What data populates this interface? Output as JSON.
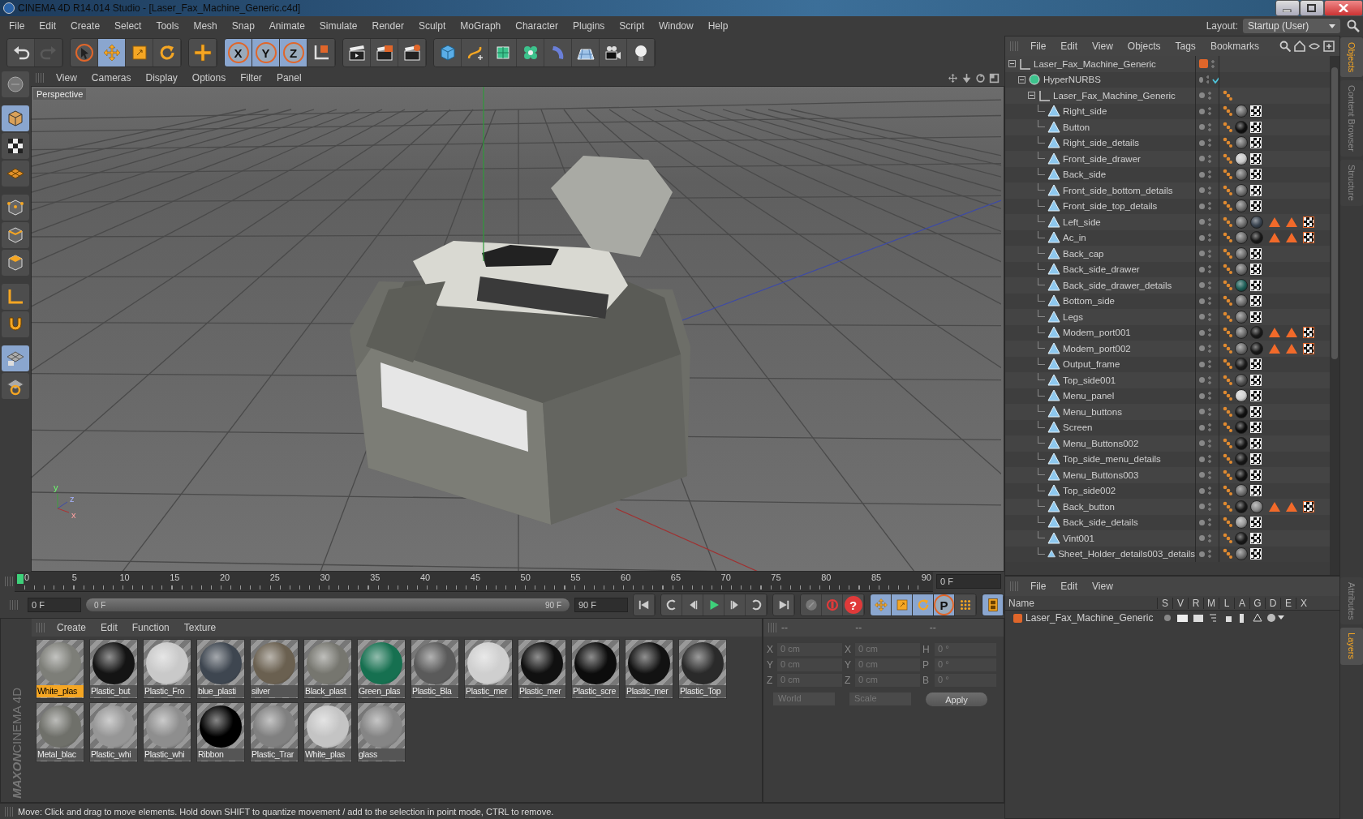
{
  "window": {
    "title": "CINEMA 4D R14.014 Studio - [Laser_Fax_Machine_Generic.c4d]"
  },
  "menu": [
    "File",
    "Edit",
    "Create",
    "Select",
    "Tools",
    "Mesh",
    "Snap",
    "Animate",
    "Simulate",
    "Render",
    "Sculpt",
    "MoGraph",
    "Character",
    "Plugins",
    "Script",
    "Window",
    "Help"
  ],
  "layout": {
    "label": "Layout:",
    "value": "Startup (User)"
  },
  "toolbar": [
    [
      {
        "kind": "undo",
        "disabled": false
      },
      {
        "kind": "redo",
        "disabled": true
      }
    ],
    [
      {
        "kind": "select",
        "selected": false
      },
      {
        "kind": "move",
        "selected": true
      },
      {
        "kind": "scale",
        "selected": false
      },
      {
        "kind": "rotate",
        "selected": false
      }
    ],
    [
      {
        "kind": "add",
        "selected": false
      }
    ],
    [
      {
        "kind": "axis",
        "label": "X",
        "selected": true
      },
      {
        "kind": "axis",
        "label": "Y",
        "selected": true
      },
      {
        "kind": "axis",
        "label": "Z",
        "selected": true
      },
      {
        "kind": "coordinate-system",
        "selected": false
      }
    ],
    [
      {
        "kind": "render-view",
        "selected": false
      },
      {
        "kind": "render",
        "selected": false
      },
      {
        "kind": "render-settings",
        "selected": false
      }
    ],
    [
      {
        "kind": "cube",
        "selected": false
      },
      {
        "kind": "spline",
        "selected": false
      },
      {
        "kind": "nurbs",
        "selected": false
      },
      {
        "kind": "cloner",
        "selected": false
      },
      {
        "kind": "deformer",
        "selected": false
      },
      {
        "kind": "scene",
        "selected": false
      },
      {
        "kind": "camera",
        "selected": false
      },
      {
        "kind": "light",
        "selected": false
      }
    ]
  ],
  "left_tools": [
    {
      "kind": "make-editable",
      "selected": false
    },
    {
      "kind": "model",
      "selected": true
    },
    {
      "kind": "texture",
      "selected": false
    },
    {
      "kind": "workplane",
      "selected": false
    },
    {
      "kind": "points",
      "selected": false
    },
    {
      "kind": "edges",
      "selected": false
    },
    {
      "kind": "polygons",
      "selected": false
    },
    {
      "kind": "axis-tool",
      "selected": false
    },
    {
      "kind": "magnet",
      "selected": false
    },
    {
      "kind": "grid-lock",
      "selected": true
    },
    {
      "kind": "snap",
      "selected": false
    }
  ],
  "viewport": {
    "menu": [
      "View",
      "Cameras",
      "Display",
      "Options",
      "Filter",
      "Panel"
    ],
    "camera": "Perspective",
    "axis_labels": [
      "y",
      "z",
      "x"
    ]
  },
  "timeline": {
    "ticks": [
      "0",
      "5",
      "10",
      "15",
      "20",
      "25",
      "30",
      "35",
      "40",
      "45",
      "50",
      "55",
      "60",
      "65",
      "70",
      "75",
      "80",
      "85",
      "90"
    ],
    "current": "0 F",
    "start_field": "0 F",
    "range": {
      "start": "0 F",
      "end": "90 F",
      "level": 1
    },
    "end_field": "90 F",
    "buttons": [
      [
        {
          "kind": "first-frame",
          "selected": false
        }
      ],
      [
        {
          "kind": "loop",
          "selected": false
        },
        {
          "kind": "prev-frame",
          "selected": false
        },
        {
          "kind": "play",
          "selected": false
        },
        {
          "kind": "next-frame",
          "selected": false
        },
        {
          "kind": "loop-back",
          "selected": false
        }
      ],
      [
        {
          "kind": "last-frame",
          "selected": false
        }
      ],
      [
        {
          "kind": "keyframe",
          "selected": false
        },
        {
          "kind": "record",
          "selected": false
        },
        {
          "kind": "help",
          "label": "?",
          "selected": false
        }
      ],
      [
        {
          "kind": "move",
          "selected": true
        },
        {
          "kind": "scale",
          "selected": true
        },
        {
          "kind": "rotate",
          "selected": true
        },
        {
          "kind": "param",
          "label": "P",
          "selected": true
        },
        {
          "kind": "points-grid",
          "selected": false
        }
      ],
      [
        {
          "kind": "film",
          "selected": true
        }
      ]
    ]
  },
  "materials": {
    "menu": [
      "Create",
      "Edit",
      "Function",
      "Texture"
    ],
    "items": [
      {
        "name": "White_plas",
        "color": "#7d7e78",
        "selected": true
      },
      {
        "name": "Plastic_but",
        "color": "#141414",
        "selected": false
      },
      {
        "name": "Plastic_Fro",
        "color": "#c9c9c9",
        "selected": false
      },
      {
        "name": "blue_plasti",
        "color": "#3e4650",
        "selected": false
      },
      {
        "name": "silver",
        "color": "#6a6050",
        "selected": false
      },
      {
        "name": "Black_plast",
        "color": "#76766f",
        "selected": false
      },
      {
        "name": "Green_plas",
        "color": "#167050",
        "selected": false
      },
      {
        "name": "Plastic_Bla",
        "color": "#5a5a5a",
        "selected": false
      },
      {
        "name": "Plastic_mer",
        "color": "#cfcfcf",
        "selected": false
      },
      {
        "name": "Plastic_mer",
        "color": "#101010",
        "selected": false
      },
      {
        "name": "Plastic_scre",
        "color": "#0c0c0c",
        "selected": false
      },
      {
        "name": "Plastic_mer",
        "color": "#121212",
        "selected": false
      },
      {
        "name": "Plastic_Top",
        "color": "#2a2a2a",
        "selected": false
      },
      {
        "name": "Metal_blac",
        "color": "#6f706a",
        "selected": false
      },
      {
        "name": "Plastic_whi",
        "color": "#969696",
        "selected": false
      },
      {
        "name": "Plastic_whi",
        "color": "#8e8e8e",
        "selected": false
      },
      {
        "name": "Ribbon",
        "color": "#000000",
        "selected": false
      },
      {
        "name": "Plastic_Trar",
        "color": "#808080",
        "selected": false
      },
      {
        "name": "White_plas",
        "color": "#c4c4c4",
        "selected": false
      },
      {
        "name": "glass",
        "color": "#858585",
        "selected": false
      }
    ],
    "logo": [
      "MAXON",
      "CINEMA 4D"
    ]
  },
  "coordinates": {
    "headers": [
      "--",
      "--",
      "--"
    ],
    "rows": [
      {
        "axis": "X",
        "position": "0 cm",
        "axis2": "X",
        "size": "0 cm",
        "rot_axis": "H",
        "rotation": "0 °"
      },
      {
        "axis": "Y",
        "position": "0 cm",
        "axis2": "Y",
        "size": "0 cm",
        "rot_axis": "P",
        "rotation": "0 °"
      },
      {
        "axis": "Z",
        "position": "0 cm",
        "axis2": "Z",
        "size": "0 cm",
        "rot_axis": "B",
        "rotation": "0 °"
      }
    ],
    "mode": "World",
    "size_mode": "Scale",
    "apply": "Apply"
  },
  "status_bar": "Move: Click and drag to move elements. Hold down SHIFT to quantize movement / add to the selection in point mode, CTRL to remove.",
  "objects_manager": {
    "menu": [
      "File",
      "Edit",
      "View",
      "Objects",
      "Tags",
      "Bookmarks"
    ],
    "tree": [
      {
        "name": "Laser_Fax_Machine_Generic",
        "kind": "null",
        "expanded": true,
        "color": "#e0662a",
        "children": [
          {
            "name": "HyperNURBS",
            "kind": "nurbs",
            "expanded": true,
            "enabled": true,
            "children": [
              {
                "name": "Laser_Fax_Machine_Generic",
                "kind": "null",
                "expanded": true,
                "phong": true,
                "children": [
                  {
                    "name": "Right_side",
                    "kind": "polygon",
                    "phong": true,
                    "materials": [
                      {
                        "color": "#6e6e6e"
                      }
                    ],
                    "warnings": false
                  },
                  {
                    "name": "Button",
                    "kind": "polygon",
                    "phong": true,
                    "materials": [
                      {
                        "color": "#111111"
                      }
                    ],
                    "warnings": false
                  },
                  {
                    "name": "Right_side_details",
                    "kind": "polygon",
                    "phong": true,
                    "materials": [
                      {
                        "color": "#6e6e6e"
                      }
                    ],
                    "warnings": false
                  },
                  {
                    "name": "Front_side_drawer",
                    "kind": "polygon",
                    "phong": true,
                    "materials": [
                      {
                        "color": "#c8c8c8"
                      }
                    ],
                    "warnings": false
                  },
                  {
                    "name": "Back_side",
                    "kind": "polygon",
                    "phong": true,
                    "materials": [
                      {
                        "color": "#6e6e6e"
                      }
                    ],
                    "warnings": false
                  },
                  {
                    "name": "Front_side_bottom_details",
                    "kind": "polygon",
                    "phong": true,
                    "materials": [
                      {
                        "color": "#6e6e6e"
                      }
                    ],
                    "warnings": false
                  },
                  {
                    "name": "Front_side_top_details",
                    "kind": "polygon",
                    "phong": true,
                    "materials": [
                      {
                        "color": "#6e6e6e"
                      }
                    ],
                    "warnings": false
                  },
                  {
                    "name": "Left_side",
                    "kind": "polygon",
                    "phong": true,
                    "materials": [
                      {
                        "color": "#6e6e6e"
                      },
                      {
                        "color": "#3a4450"
                      }
                    ],
                    "warnings": true
                  },
                  {
                    "name": "Ac_in",
                    "kind": "polygon",
                    "phong": true,
                    "materials": [
                      {
                        "color": "#6e6e6e"
                      },
                      {
                        "color": "#1a1a1a"
                      }
                    ],
                    "warnings": true
                  },
                  {
                    "name": "Back_cap",
                    "kind": "polygon",
                    "phong": true,
                    "materials": [
                      {
                        "color": "#6e6e6e"
                      }
                    ],
                    "warnings": false
                  },
                  {
                    "name": "Back_side_drawer",
                    "kind": "polygon",
                    "phong": true,
                    "materials": [
                      {
                        "color": "#6e6e6e"
                      }
                    ],
                    "warnings": false
                  },
                  {
                    "name": "Back_side_drawer_details",
                    "kind": "polygon",
                    "phong": true,
                    "materials": [
                      {
                        "color": "#1f5f58"
                      }
                    ],
                    "warnings": false
                  },
                  {
                    "name": "Bottom_side",
                    "kind": "polygon",
                    "phong": true,
                    "materials": [
                      {
                        "color": "#6e6e6e"
                      }
                    ],
                    "warnings": false
                  },
                  {
                    "name": "Legs",
                    "kind": "polygon",
                    "phong": true,
                    "materials": [
                      {
                        "color": "#6e6e6e"
                      }
                    ],
                    "warnings": false
                  },
                  {
                    "name": "Modem_port001",
                    "kind": "polygon",
                    "phong": true,
                    "materials": [
                      {
                        "color": "#6e6e6e"
                      },
                      {
                        "color": "#1a1a1a"
                      }
                    ],
                    "warnings": true
                  },
                  {
                    "name": "Modem_port002",
                    "kind": "polygon",
                    "phong": true,
                    "materials": [
                      {
                        "color": "#6e6e6e"
                      },
                      {
                        "color": "#1a1a1a"
                      }
                    ],
                    "warnings": true
                  },
                  {
                    "name": "Output_frame",
                    "kind": "polygon",
                    "phong": true,
                    "materials": [
                      {
                        "color": "#1c1c1c"
                      }
                    ],
                    "warnings": false
                  },
                  {
                    "name": "Top_side001",
                    "kind": "polygon",
                    "phong": true,
                    "materials": [
                      {
                        "color": "#505050"
                      }
                    ],
                    "warnings": false
                  },
                  {
                    "name": "Menu_panel",
                    "kind": "polygon",
                    "phong": true,
                    "materials": [
                      {
                        "color": "#d0d0d0"
                      }
                    ],
                    "warnings": false
                  },
                  {
                    "name": "Menu_buttons",
                    "kind": "polygon",
                    "phong": true,
                    "materials": [
                      {
                        "color": "#111111"
                      }
                    ],
                    "warnings": false
                  },
                  {
                    "name": "Screen",
                    "kind": "polygon",
                    "phong": true,
                    "materials": [
                      {
                        "color": "#0e0e0e"
                      }
                    ],
                    "warnings": false
                  },
                  {
                    "name": "Menu_Buttons002",
                    "kind": "polygon",
                    "phong": true,
                    "materials": [
                      {
                        "color": "#151515"
                      }
                    ],
                    "warnings": false
                  },
                  {
                    "name": "Top_side_menu_details",
                    "kind": "polygon",
                    "phong": true,
                    "materials": [
                      {
                        "color": "#181818"
                      }
                    ],
                    "warnings": false
                  },
                  {
                    "name": "Menu_Buttons003",
                    "kind": "polygon",
                    "phong": true,
                    "materials": [
                      {
                        "color": "#131313"
                      }
                    ],
                    "warnings": false
                  },
                  {
                    "name": "Top_side002",
                    "kind": "polygon",
                    "phong": true,
                    "materials": [
                      {
                        "color": "#6e6e6e"
                      }
                    ],
                    "warnings": false
                  },
                  {
                    "name": "Back_button",
                    "kind": "polygon",
                    "phong": true,
                    "materials": [
                      {
                        "color": "#1a1a1a"
                      },
                      {
                        "color": "#8a8a8a"
                      }
                    ],
                    "warnings": true
                  },
                  {
                    "name": "Back_side_details",
                    "kind": "polygon",
                    "phong": true,
                    "materials": [
                      {
                        "color": "#9a9a9a"
                      }
                    ],
                    "warnings": false
                  },
                  {
                    "name": "Vint001",
                    "kind": "polygon",
                    "phong": true,
                    "materials": [
                      {
                        "color": "#1a1a1a"
                      }
                    ],
                    "warnings": false
                  },
                  {
                    "name": "Sheet_Holder_details003_details",
                    "kind": "polygon",
                    "phong": true,
                    "materials": [
                      {
                        "color": "#6e6e6e"
                      }
                    ],
                    "warnings": false
                  }
                ]
              }
            ]
          }
        ]
      }
    ]
  },
  "side_tabs_top": [
    {
      "label": "Objects",
      "selected": true
    },
    {
      "label": "Content Browser",
      "selected": false
    },
    {
      "label": "Structure",
      "selected": false
    }
  ],
  "layers_manager": {
    "menu": [
      "File",
      "Edit",
      "View"
    ],
    "columns": [
      "Name",
      "S",
      "V",
      "R",
      "M",
      "L",
      "A",
      "G",
      "D",
      "E",
      "X"
    ],
    "rows": [
      {
        "name": "Laser_Fax_Machine_Generic",
        "color": "#e0662a"
      }
    ]
  },
  "side_tabs_bottom": [
    {
      "label": "Attributes",
      "selected": false
    },
    {
      "label": "Layers",
      "selected": true
    }
  ]
}
